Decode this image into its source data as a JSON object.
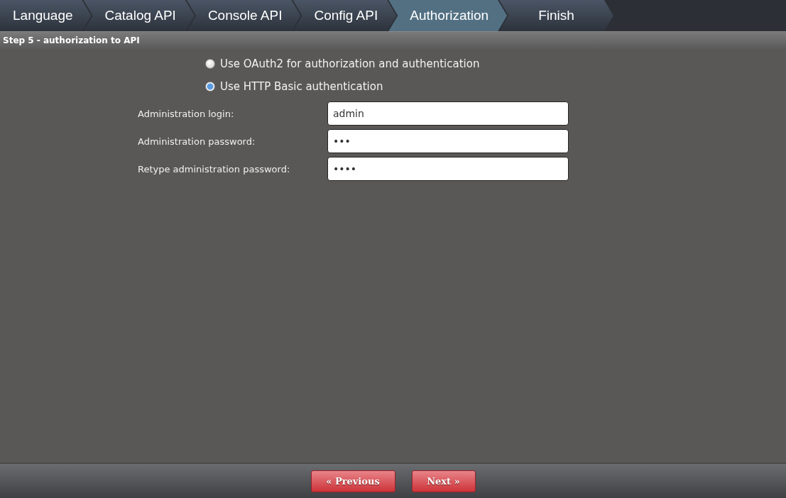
{
  "steps": [
    {
      "label": "Language",
      "selected": false
    },
    {
      "label": "Catalog API",
      "selected": false
    },
    {
      "label": "Console API",
      "selected": false
    },
    {
      "label": "Config API",
      "selected": false
    },
    {
      "label": "Authorization",
      "selected": true
    },
    {
      "label": "Finish",
      "selected": false
    }
  ],
  "section_title": "Step 5 - authorization to API",
  "auth_options": [
    {
      "label": "Use OAuth2 for authorization and authentication",
      "selected": false
    },
    {
      "label": "Use HTTP Basic authentication",
      "selected": true
    }
  ],
  "fields": [
    {
      "label": "Administration login:",
      "value": "admin"
    },
    {
      "label": "Administration password:",
      "value": "•••"
    },
    {
      "label": "Retype administration password:",
      "value": "••••"
    }
  ],
  "buttons": [
    "« Previous",
    "Next »"
  ]
}
